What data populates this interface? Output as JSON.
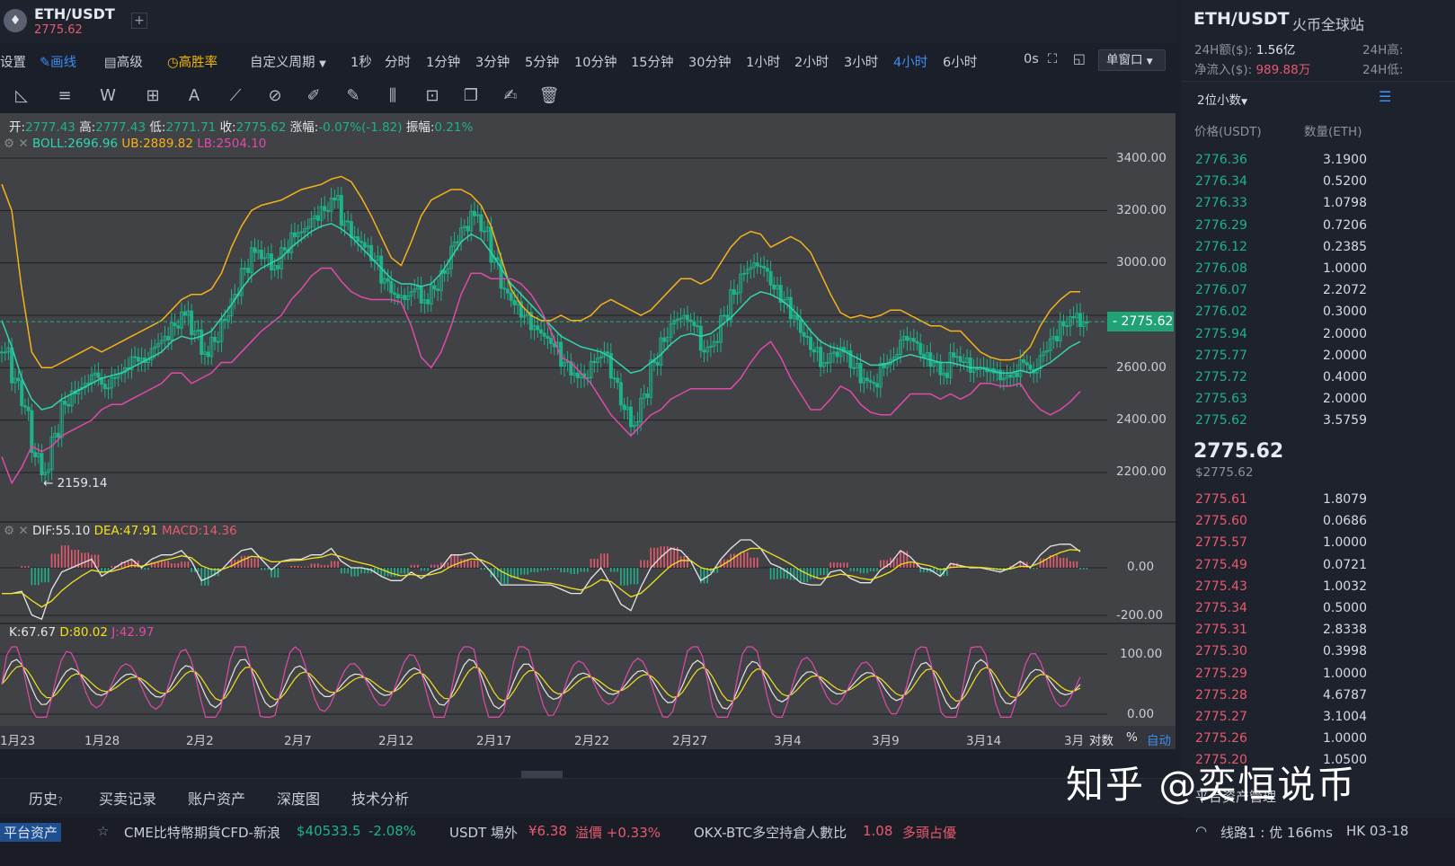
{
  "header": {
    "symbol": "ETH/USDT",
    "last_price": "2775.62",
    "add_tab": "+"
  },
  "periods": {
    "settings": "设置",
    "draw": "画线",
    "advanced": "高级",
    "high_win": "高胜率",
    "custom": "自定义周期",
    "items": [
      "1秒",
      "分时",
      "1分钟",
      "3分钟",
      "5分钟",
      "10分钟",
      "15分钟",
      "30分钟",
      "1小时",
      "2小时",
      "3小时",
      "4小时",
      "6小时"
    ],
    "active": "4小时",
    "countdown": "0s",
    "window_mode": "单窗口"
  },
  "legend": {
    "ohlc_open_label": "开:",
    "ohlc_open": "2777.43",
    "ohlc_high_label": "高:",
    "ohlc_high": "2777.43",
    "ohlc_low_label": "低:",
    "ohlc_low": "2771.71",
    "ohlc_close_label": "收:",
    "ohlc_close": "2775.62",
    "change_label": "涨幅:",
    "change": "-0.07%(-1.82)",
    "amp_label": "振幅:",
    "amp": "0.21%",
    "boll": "BOLL:2696.96",
    "ub": "UB:2889.82",
    "lb": "LB:2504.10",
    "dif": "DIF:55.10",
    "dea": "DEA:47.91",
    "macd": "MACD:14.36",
    "k": "K:67.67",
    "d": "D:80.02",
    "j": "J:42.97",
    "low_marker": "← 2159.14",
    "price_tag": "2775.62"
  },
  "axis": {
    "price_ticks": [
      "3400.00",
      "3200.00",
      "3000.00",
      "2800.00",
      "2600.00",
      "2400.00",
      "2200.00"
    ],
    "macd_ticks": [
      "0.00",
      "-200.00"
    ],
    "kdj_ticks": [
      "100.00",
      "0.00"
    ],
    "dates": [
      "1月23",
      "1月28",
      "2月2",
      "2月7",
      "2月12",
      "2月17",
      "2月22",
      "2月27",
      "3月4",
      "3月9",
      "3月14",
      "3月"
    ],
    "log_label": "对数",
    "pct_label": "%",
    "auto_label": "自动"
  },
  "right_panel": {
    "title": "ETH/USDT",
    "exchange": "火币全球站",
    "vol_label": "24H额($):",
    "vol": "1.56亿",
    "inflow_label": "净流入($):",
    "inflow": "989.88万",
    "high_label": "24H高:",
    "low_label": "24H低:",
    "decimals": "2位小数",
    "col_price": "价格(USDT)",
    "col_qty": "数量(ETH)",
    "asks": [
      [
        "2776.36",
        "3.1900"
      ],
      [
        "2776.34",
        "0.5200"
      ],
      [
        "2776.33",
        "1.0798"
      ],
      [
        "2776.29",
        "0.7206"
      ],
      [
        "2776.12",
        "0.2385"
      ],
      [
        "2776.08",
        "1.0000"
      ],
      [
        "2776.07",
        "2.2072"
      ],
      [
        "2776.02",
        "0.3000"
      ],
      [
        "2775.94",
        "2.0000"
      ],
      [
        "2775.77",
        "2.0000"
      ],
      [
        "2775.72",
        "0.4000"
      ],
      [
        "2775.63",
        "2.0000"
      ],
      [
        "2775.62",
        "3.5759"
      ]
    ],
    "mid_price": "2775.62",
    "mid_usd": "$2775.62",
    "bids": [
      [
        "2775.61",
        "1.8079"
      ],
      [
        "2775.60",
        "0.0686"
      ],
      [
        "2775.57",
        "1.0000"
      ],
      [
        "2775.49",
        "0.0721"
      ],
      [
        "2775.43",
        "1.0032"
      ],
      [
        "2775.34",
        "0.5000"
      ],
      [
        "2775.31",
        "2.8338"
      ],
      [
        "2775.30",
        "0.3998"
      ],
      [
        "2775.29",
        "1.0000"
      ],
      [
        "2775.28",
        "4.6787"
      ],
      [
        "2775.27",
        "3.1004"
      ],
      [
        "2775.26",
        "1.0000"
      ],
      [
        "2775.20",
        "1.0500"
      ]
    ],
    "platform_assets": "平台资产管理"
  },
  "bottom_tabs": [
    "历史",
    "买卖记录",
    "账户资产",
    "深度图",
    "技术分析"
  ],
  "ticker": {
    "platform": "平台资产",
    "cme_label": "CME比特幣期貨CFD-新浪",
    "cme_value": "$40533.5",
    "cme_change": "-2.08%",
    "usdt_label": "USDT 場外",
    "usdt_value": "¥6.38",
    "usdt_premium": "溢價 +0.33%",
    "okx_label": "OKX-BTC多空持倉人數比",
    "okx_value": "1.08",
    "okx_state": "多頭占優",
    "line": "线路1 : 优 166ms",
    "region": "HK 03-18"
  },
  "watermark": "知乎 @奕恒说币",
  "colors": {
    "up": "#1fb28a",
    "down": "#e85a6d",
    "boll_mid": "#30d5b0",
    "boll_ub": "#f5b21a",
    "boll_lb": "#e04aa8",
    "accent": "#3f8cf2",
    "macd_dif": "#e6e6e6",
    "macd_dea": "#f2e21e",
    "kdj_j": "#e04aa8"
  },
  "chart_data": {
    "type": "candlestick",
    "price_ylim": [
      2100,
      3500
    ],
    "close": [
      2660,
      2560,
      2450,
      2260,
      2200,
      2350,
      2460,
      2500,
      2540,
      2580,
      2520,
      2560,
      2600,
      2640,
      2620,
      2680,
      2720,
      2760,
      2800,
      2740,
      2660,
      2700,
      2780,
      2880,
      2980,
      3040,
      3020,
      2990,
      3050,
      3100,
      3130,
      3180,
      3200,
      3240,
      3160,
      3100,
      3060,
      3010,
      2940,
      2880,
      2860,
      2900,
      2860,
      2900,
      2960,
      3080,
      3140,
      3180,
      3120,
      3020,
      2900,
      2840,
      2800,
      2760,
      2720,
      2680,
      2620,
      2580,
      2560,
      2620,
      2660,
      2560,
      2440,
      2380,
      2500,
      2620,
      2700,
      2780,
      2800,
      2760,
      2660,
      2700,
      2800,
      2880,
      2960,
      3000,
      2980,
      2900,
      2860,
      2800,
      2720,
      2660,
      2620,
      2660,
      2660,
      2600,
      2560,
      2540,
      2600,
      2640,
      2720,
      2700,
      2640,
      2620,
      2580,
      2640,
      2620,
      2600,
      2600,
      2580,
      2560,
      2580,
      2620,
      2580,
      2660,
      2720,
      2760,
      2790,
      2775
    ],
    "boll_mid": [
      2780,
      2680,
      2560,
      2480,
      2440,
      2450,
      2480,
      2500,
      2520,
      2540,
      2560,
      2570,
      2580,
      2600,
      2620,
      2640,
      2660,
      2700,
      2720,
      2710,
      2720,
      2740,
      2790,
      2840,
      2900,
      2950,
      2980,
      3000,
      3020,
      3060,
      3090,
      3120,
      3140,
      3150,
      3130,
      3100,
      3060,
      3020,
      2980,
      2940,
      2920,
      2920,
      2910,
      2920,
      2960,
      3020,
      3080,
      3110,
      3090,
      3040,
      2980,
      2920,
      2880,
      2840,
      2800,
      2760,
      2720,
      2700,
      2680,
      2670,
      2660,
      2640,
      2610,
      2580,
      2590,
      2620,
      2650,
      2690,
      2720,
      2730,
      2720,
      2730,
      2760,
      2790,
      2830,
      2870,
      2890,
      2880,
      2860,
      2830,
      2790,
      2740,
      2700,
      2680,
      2670,
      2650,
      2630,
      2610,
      2610,
      2620,
      2640,
      2650,
      2640,
      2630,
      2620,
      2620,
      2610,
      2600,
      2600,
      2590,
      2580,
      2580,
      2590,
      2580,
      2600,
      2620,
      2650,
      2680,
      2700
    ],
    "boll_ub": [
      3300,
      3200,
      2900,
      2660,
      2600,
      2600,
      2620,
      2640,
      2660,
      2680,
      2660,
      2680,
      2700,
      2720,
      2740,
      2760,
      2780,
      2820,
      2860,
      2880,
      2880,
      2900,
      2960,
      3060,
      3140,
      3200,
      3220,
      3230,
      3240,
      3260,
      3280,
      3290,
      3300,
      3320,
      3330,
      3310,
      3250,
      3180,
      3100,
      3020,
      2990,
      3080,
      3180,
      3240,
      3260,
      3280,
      3280,
      3260,
      3220,
      3140,
      3020,
      2900,
      2840,
      2800,
      2780,
      2780,
      2800,
      2780,
      2780,
      2800,
      2840,
      2860,
      2840,
      2820,
      2800,
      2820,
      2860,
      2900,
      2940,
      2940,
      2920,
      2940,
      3000,
      3060,
      3100,
      3120,
      3110,
      3060,
      3080,
      3100,
      3080,
      3040,
      2960,
      2880,
      2810,
      2790,
      2800,
      2790,
      2800,
      2820,
      2820,
      2800,
      2780,
      2760,
      2760,
      2740,
      2740,
      2700,
      2660,
      2640,
      2630,
      2630,
      2640,
      2680,
      2760,
      2820,
      2860,
      2890,
      2890
    ],
    "boll_lb": [
      2260,
      2160,
      2220,
      2300,
      2280,
      2300,
      2340,
      2360,
      2380,
      2400,
      2440,
      2460,
      2460,
      2480,
      2500,
      2520,
      2540,
      2580,
      2580,
      2540,
      2560,
      2580,
      2620,
      2620,
      2660,
      2700,
      2740,
      2770,
      2800,
      2860,
      2900,
      2950,
      2980,
      2980,
      2930,
      2890,
      2870,
      2860,
      2860,
      2860,
      2850,
      2760,
      2640,
      2600,
      2660,
      2760,
      2880,
      2960,
      2960,
      2940,
      2940,
      2940,
      2920,
      2880,
      2820,
      2740,
      2640,
      2620,
      2580,
      2540,
      2480,
      2420,
      2380,
      2340,
      2380,
      2420,
      2440,
      2480,
      2500,
      2520,
      2520,
      2520,
      2520,
      2520,
      2560,
      2620,
      2670,
      2700,
      2640,
      2560,
      2500,
      2440,
      2440,
      2480,
      2530,
      2510,
      2460,
      2430,
      2420,
      2420,
      2460,
      2500,
      2500,
      2500,
      2480,
      2500,
      2480,
      2500,
      2540,
      2540,
      2530,
      2530,
      2540,
      2480,
      2440,
      2420,
      2440,
      2470,
      2510
    ],
    "macd_ylim": [
      -220,
      100
    ],
    "kdj_ylim": [
      0,
      110
    ]
  }
}
